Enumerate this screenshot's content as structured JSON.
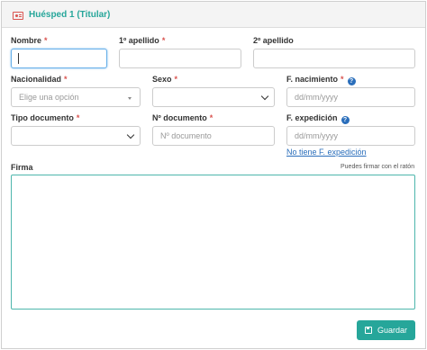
{
  "header": {
    "icon": "id-card-icon",
    "title": "Huésped 1 (Titular)",
    "accent": "#26a69a"
  },
  "fields": {
    "nombre": {
      "label": "Nombre",
      "required": "*",
      "value": ""
    },
    "apellido1": {
      "label": "1º apellido",
      "required": "*",
      "value": ""
    },
    "apellido2": {
      "label": "2º apellido",
      "value": ""
    },
    "nacionalidad": {
      "label": "Nacionalidad",
      "required": "*",
      "placeholder": "Elige una opción"
    },
    "sexo": {
      "label": "Sexo",
      "required": "*",
      "value": ""
    },
    "nacimiento": {
      "label": "F. nacimiento",
      "required": "*",
      "placeholder": "dd/mm/yyyy"
    },
    "tipo_documento": {
      "label": "Tipo documento",
      "required": "*",
      "value": ""
    },
    "num_documento": {
      "label": "Nº documento",
      "required": "*",
      "placeholder": "Nº documento"
    },
    "expedicion": {
      "label": "F. expedición",
      "placeholder": "dd/mm/yyyy",
      "link": "No tiene F. expedición"
    }
  },
  "firma": {
    "label": "Firma",
    "hint": "Puedes firmar con el ratón"
  },
  "actions": {
    "save_label": "Guardar",
    "save_icon": "floppy-disk-icon"
  },
  "colors": {
    "required": "#d9534f",
    "primary": "#26a69a",
    "help": "#2a6ebb",
    "focus": "#66afe9"
  }
}
